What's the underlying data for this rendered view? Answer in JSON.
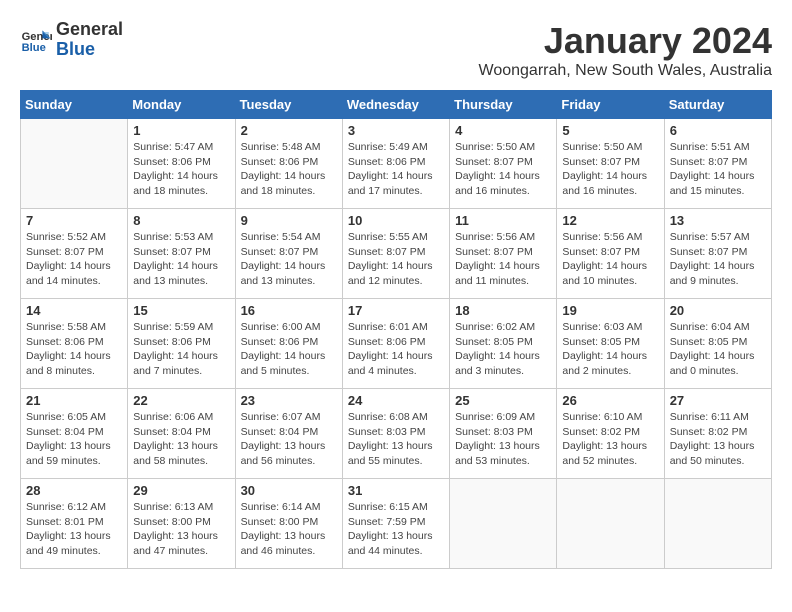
{
  "header": {
    "logo_line1": "General",
    "logo_line2": "Blue",
    "month": "January 2024",
    "location": "Woongarrah, New South Wales, Australia"
  },
  "weekdays": [
    "Sunday",
    "Monday",
    "Tuesday",
    "Wednesday",
    "Thursday",
    "Friday",
    "Saturday"
  ],
  "weeks": [
    [
      {
        "day": "",
        "info": ""
      },
      {
        "day": "1",
        "info": "Sunrise: 5:47 AM\nSunset: 8:06 PM\nDaylight: 14 hours\nand 18 minutes."
      },
      {
        "day": "2",
        "info": "Sunrise: 5:48 AM\nSunset: 8:06 PM\nDaylight: 14 hours\nand 18 minutes."
      },
      {
        "day": "3",
        "info": "Sunrise: 5:49 AM\nSunset: 8:06 PM\nDaylight: 14 hours\nand 17 minutes."
      },
      {
        "day": "4",
        "info": "Sunrise: 5:50 AM\nSunset: 8:07 PM\nDaylight: 14 hours\nand 16 minutes."
      },
      {
        "day": "5",
        "info": "Sunrise: 5:50 AM\nSunset: 8:07 PM\nDaylight: 14 hours\nand 16 minutes."
      },
      {
        "day": "6",
        "info": "Sunrise: 5:51 AM\nSunset: 8:07 PM\nDaylight: 14 hours\nand 15 minutes."
      }
    ],
    [
      {
        "day": "7",
        "info": "Sunrise: 5:52 AM\nSunset: 8:07 PM\nDaylight: 14 hours\nand 14 minutes."
      },
      {
        "day": "8",
        "info": "Sunrise: 5:53 AM\nSunset: 8:07 PM\nDaylight: 14 hours\nand 13 minutes."
      },
      {
        "day": "9",
        "info": "Sunrise: 5:54 AM\nSunset: 8:07 PM\nDaylight: 14 hours\nand 13 minutes."
      },
      {
        "day": "10",
        "info": "Sunrise: 5:55 AM\nSunset: 8:07 PM\nDaylight: 14 hours\nand 12 minutes."
      },
      {
        "day": "11",
        "info": "Sunrise: 5:56 AM\nSunset: 8:07 PM\nDaylight: 14 hours\nand 11 minutes."
      },
      {
        "day": "12",
        "info": "Sunrise: 5:56 AM\nSunset: 8:07 PM\nDaylight: 14 hours\nand 10 minutes."
      },
      {
        "day": "13",
        "info": "Sunrise: 5:57 AM\nSunset: 8:07 PM\nDaylight: 14 hours\nand 9 minutes."
      }
    ],
    [
      {
        "day": "14",
        "info": "Sunrise: 5:58 AM\nSunset: 8:06 PM\nDaylight: 14 hours\nand 8 minutes."
      },
      {
        "day": "15",
        "info": "Sunrise: 5:59 AM\nSunset: 8:06 PM\nDaylight: 14 hours\nand 7 minutes."
      },
      {
        "day": "16",
        "info": "Sunrise: 6:00 AM\nSunset: 8:06 PM\nDaylight: 14 hours\nand 5 minutes."
      },
      {
        "day": "17",
        "info": "Sunrise: 6:01 AM\nSunset: 8:06 PM\nDaylight: 14 hours\nand 4 minutes."
      },
      {
        "day": "18",
        "info": "Sunrise: 6:02 AM\nSunset: 8:05 PM\nDaylight: 14 hours\nand 3 minutes."
      },
      {
        "day": "19",
        "info": "Sunrise: 6:03 AM\nSunset: 8:05 PM\nDaylight: 14 hours\nand 2 minutes."
      },
      {
        "day": "20",
        "info": "Sunrise: 6:04 AM\nSunset: 8:05 PM\nDaylight: 14 hours\nand 0 minutes."
      }
    ],
    [
      {
        "day": "21",
        "info": "Sunrise: 6:05 AM\nSunset: 8:04 PM\nDaylight: 13 hours\nand 59 minutes."
      },
      {
        "day": "22",
        "info": "Sunrise: 6:06 AM\nSunset: 8:04 PM\nDaylight: 13 hours\nand 58 minutes."
      },
      {
        "day": "23",
        "info": "Sunrise: 6:07 AM\nSunset: 8:04 PM\nDaylight: 13 hours\nand 56 minutes."
      },
      {
        "day": "24",
        "info": "Sunrise: 6:08 AM\nSunset: 8:03 PM\nDaylight: 13 hours\nand 55 minutes."
      },
      {
        "day": "25",
        "info": "Sunrise: 6:09 AM\nSunset: 8:03 PM\nDaylight: 13 hours\nand 53 minutes."
      },
      {
        "day": "26",
        "info": "Sunrise: 6:10 AM\nSunset: 8:02 PM\nDaylight: 13 hours\nand 52 minutes."
      },
      {
        "day": "27",
        "info": "Sunrise: 6:11 AM\nSunset: 8:02 PM\nDaylight: 13 hours\nand 50 minutes."
      }
    ],
    [
      {
        "day": "28",
        "info": "Sunrise: 6:12 AM\nSunset: 8:01 PM\nDaylight: 13 hours\nand 49 minutes."
      },
      {
        "day": "29",
        "info": "Sunrise: 6:13 AM\nSunset: 8:00 PM\nDaylight: 13 hours\nand 47 minutes."
      },
      {
        "day": "30",
        "info": "Sunrise: 6:14 AM\nSunset: 8:00 PM\nDaylight: 13 hours\nand 46 minutes."
      },
      {
        "day": "31",
        "info": "Sunrise: 6:15 AM\nSunset: 7:59 PM\nDaylight: 13 hours\nand 44 minutes."
      },
      {
        "day": "",
        "info": ""
      },
      {
        "day": "",
        "info": ""
      },
      {
        "day": "",
        "info": ""
      }
    ]
  ]
}
